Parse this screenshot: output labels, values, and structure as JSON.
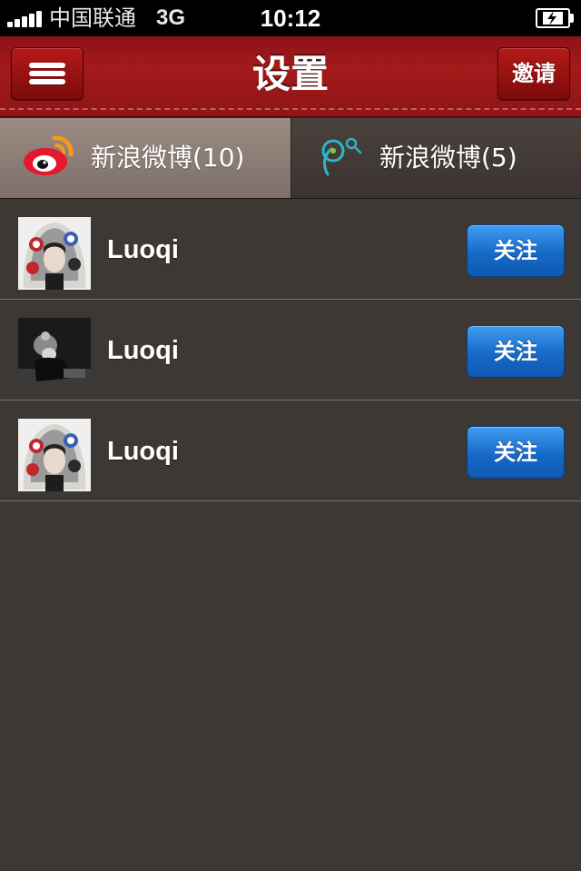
{
  "status_bar": {
    "carrier": "中国联通",
    "network": "3G",
    "time": "10:12",
    "signal_icon": "signal-bars-icon",
    "battery_icon": "battery-charging-icon"
  },
  "nav": {
    "title": "设置",
    "menu_icon": "menu-icon",
    "invite_label": "邀请"
  },
  "tabs": [
    {
      "label": "新浪微博(10)",
      "icon": "sina-weibo-icon",
      "selected": true
    },
    {
      "label": "新浪微博(5)",
      "icon": "tencent-weibo-icon",
      "selected": false
    }
  ],
  "users": [
    {
      "name": "Luoqi",
      "button": "关注"
    },
    {
      "name": "Luoqi",
      "button": "关注"
    },
    {
      "name": "Luoqi",
      "button": "关注"
    }
  ],
  "colors": {
    "nav_red": "#a31a1b",
    "follow_blue": "#1769c8",
    "background": "#3e3834"
  }
}
